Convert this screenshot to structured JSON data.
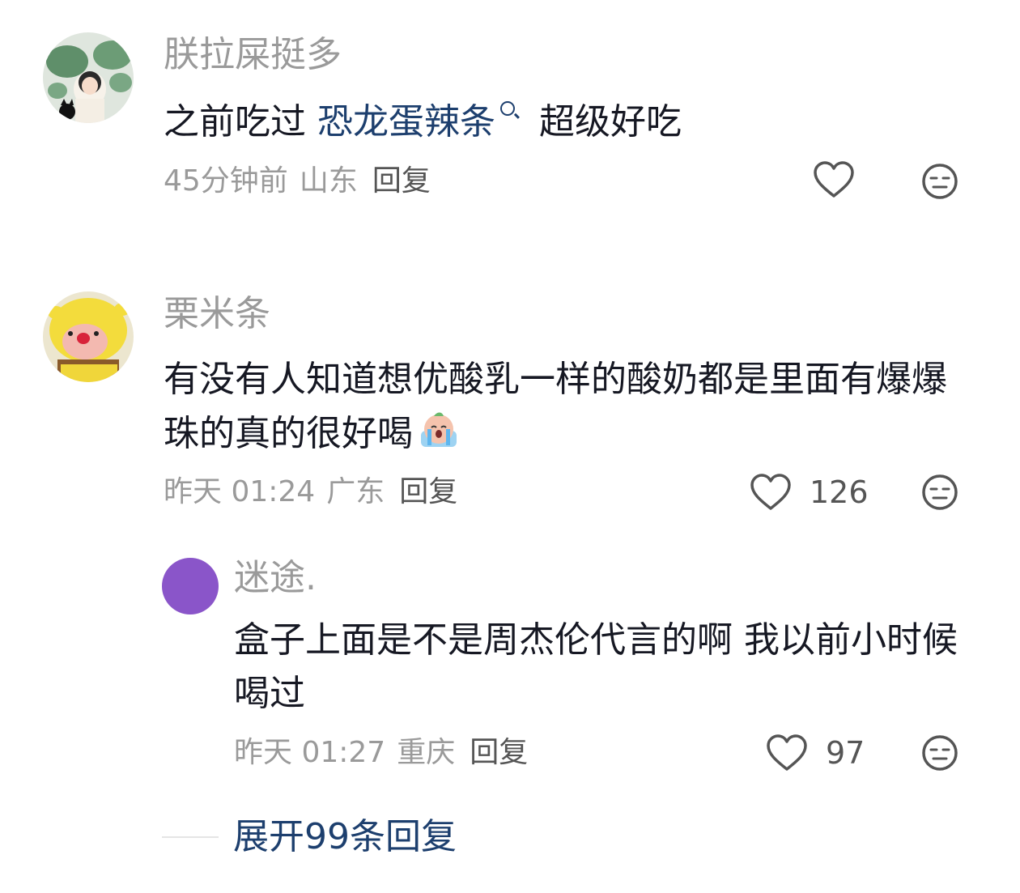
{
  "comments": [
    {
      "username": "朕拉屎挺多",
      "text_before": "之前吃过 ",
      "hashtag": "恐龙蛋辣条",
      "text_after": "超级好吃",
      "time": "45分钟前",
      "region": "山东",
      "reply_label": "回复",
      "likes": ""
    },
    {
      "username": "栗米条",
      "text": "有没有人知道想优酸乳一样的酸奶都是里面有爆爆珠的真的很好喝",
      "time": "昨天 01:24",
      "region": "广东",
      "reply_label": "回复",
      "likes": "126"
    },
    {
      "username": "迷途.",
      "text": "盒子上面是不是周杰伦代言的啊 我以前小时候喝过",
      "time": "昨天 01:27",
      "region": "重庆",
      "reply_label": "回复",
      "likes": "97"
    }
  ],
  "expand_replies": "展开99条回复",
  "colors": {
    "username": "#9a9a9a",
    "text": "#161823",
    "hashtag": "#1d3f6e",
    "icon": "#555555",
    "avatar_purple": "#8a55c9"
  },
  "icons": {
    "like": "heart-outline-icon",
    "dislike": "meh-face-icon",
    "hashtag_search": "search-icon",
    "crying_emoji": "crying-emoji-icon"
  }
}
